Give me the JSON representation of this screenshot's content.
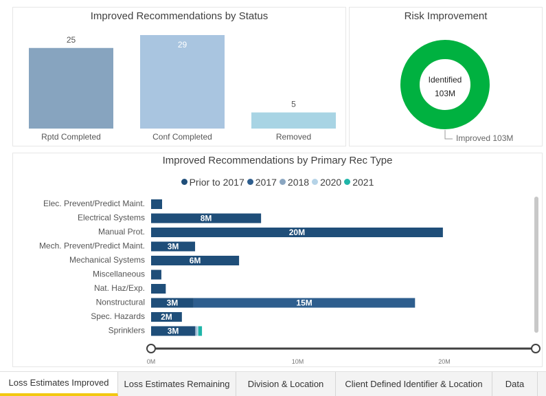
{
  "status_panel": {
    "title": "Improved Recommendations by Status",
    "chart_data": {
      "type": "bar",
      "categories": [
        "Rptd Completed",
        "Conf Completed",
        "Removed"
      ],
      "values": [
        25,
        29,
        5
      ],
      "colors": [
        "#87a4bf",
        "#a9c5e0",
        "#a8d4e4"
      ]
    }
  },
  "risk_panel": {
    "title": "Risk Improvement",
    "chart_data": {
      "type": "pie",
      "center_label": "Identified",
      "center_value": "103M",
      "slices": [
        {
          "name": "Improved",
          "value": 103,
          "label": "Improved 103M",
          "color": "#00b140"
        }
      ]
    }
  },
  "rec_type_panel": {
    "title": "Improved Recommendations by Primary Rec Type",
    "chart_data": {
      "type": "bar",
      "orientation": "horizontal",
      "stacked": true,
      "legend": [
        {
          "name": "Prior to 2017",
          "color": "#1f4e79"
        },
        {
          "name": "2017",
          "color": "#2e5e8e"
        },
        {
          "name": "2018",
          "color": "#8aa6c1"
        },
        {
          "name": "2020",
          "color": "#b5d3e7"
        },
        {
          "name": "2021",
          "color": "#1fb5a8"
        }
      ],
      "categories": [
        "Elec. Prevent/Predict Maint.",
        "Electrical Systems",
        "Manual Prot.",
        "Mech. Prevent/Predict Maint.",
        "Mechanical Systems",
        "Miscellaneous",
        "Nat. Haz/Exp.",
        "Nonstructural",
        "Spec. Hazards",
        "Sprinklers"
      ],
      "series": [
        {
          "name": "Prior to 2017",
          "values": [
            0.75,
            7.5,
            19.9,
            3.0,
            6.0,
            0.7,
            1.0,
            2.9,
            2.1,
            3.0
          ],
          "labels": [
            "",
            "8M",
            "20M",
            "3M",
            "6M",
            "",
            "",
            "3M",
            "2M",
            "3M"
          ]
        },
        {
          "name": "2017",
          "values": [
            0,
            0,
            0,
            0,
            0,
            0,
            0,
            15.1,
            0,
            0
          ],
          "labels": [
            "",
            "",
            "",
            "",
            "",
            "",
            "",
            "15M",
            "",
            ""
          ]
        },
        {
          "name": "2018",
          "values": [
            0,
            0,
            0,
            0,
            0,
            0,
            0,
            0,
            0,
            0.1
          ],
          "labels": [
            "",
            "",
            "",
            "",
            "",
            "",
            "",
            "",
            "",
            ""
          ]
        },
        {
          "name": "2020",
          "values": [
            0,
            0,
            0,
            0,
            0,
            0,
            0,
            0,
            0,
            0.12
          ],
          "labels": [
            "",
            "",
            "",
            "",
            "",
            "",
            "",
            "",
            "",
            ""
          ]
        },
        {
          "name": "2021",
          "values": [
            0,
            0,
            0,
            0,
            0,
            0,
            0,
            0,
            0,
            0.25
          ],
          "labels": [
            "",
            "",
            "",
            "",
            "",
            "",
            "",
            "",
            "",
            ""
          ]
        }
      ],
      "xlim": [
        0,
        26
      ],
      "x_ticks": [
        {
          "value": 0,
          "label": "0M"
        },
        {
          "value": 10,
          "label": "10M"
        },
        {
          "value": 20,
          "label": "20M"
        }
      ]
    }
  },
  "tabs": [
    {
      "label": "Loss Estimates Improved",
      "active": true
    },
    {
      "label": "Loss Estimates Remaining",
      "active": false
    },
    {
      "label": "Division & Location",
      "active": false
    },
    {
      "label": "Client Defined Identifier & Location",
      "active": false
    },
    {
      "label": "Data",
      "active": false
    }
  ]
}
